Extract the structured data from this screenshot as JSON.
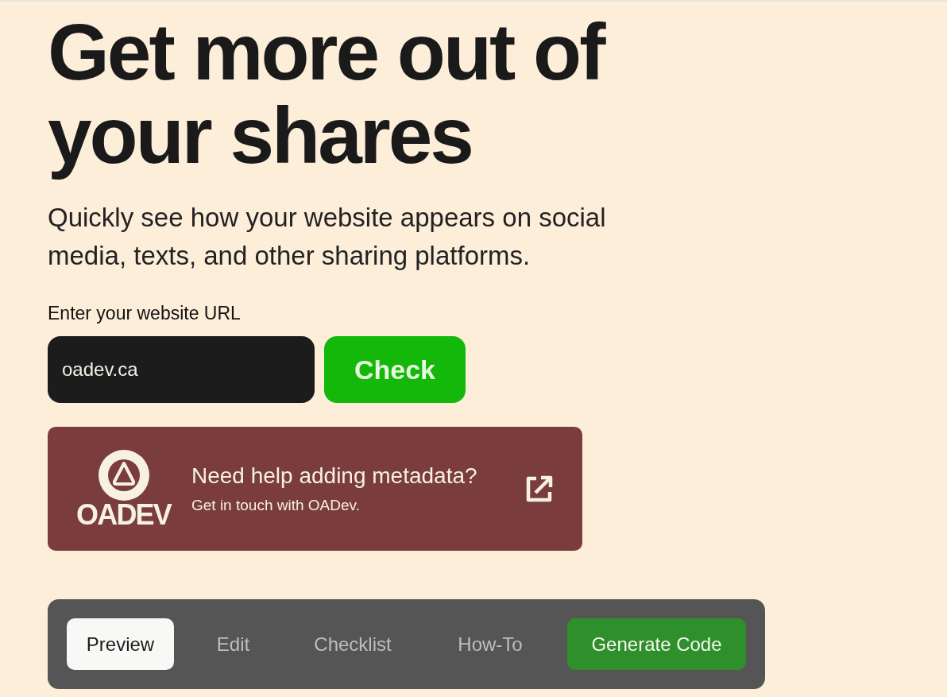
{
  "hero": {
    "title": "Get more out of your shares",
    "subtitle": "Quickly see how your website appears on social media, texts, and other sharing platforms."
  },
  "url_form": {
    "label": "Enter your website URL",
    "value": "oadev.ca",
    "button": "Check"
  },
  "help_card": {
    "logo_text": "OADEV",
    "title": "Need help adding metadata?",
    "subtitle": "Get in touch with OADev."
  },
  "tabs": [
    {
      "label": "Preview",
      "selected": true
    },
    {
      "label": "Edit",
      "selected": false
    },
    {
      "label": "Checklist",
      "selected": false
    },
    {
      "label": "How-To",
      "selected": false
    }
  ],
  "generate_button": "Generate Code"
}
